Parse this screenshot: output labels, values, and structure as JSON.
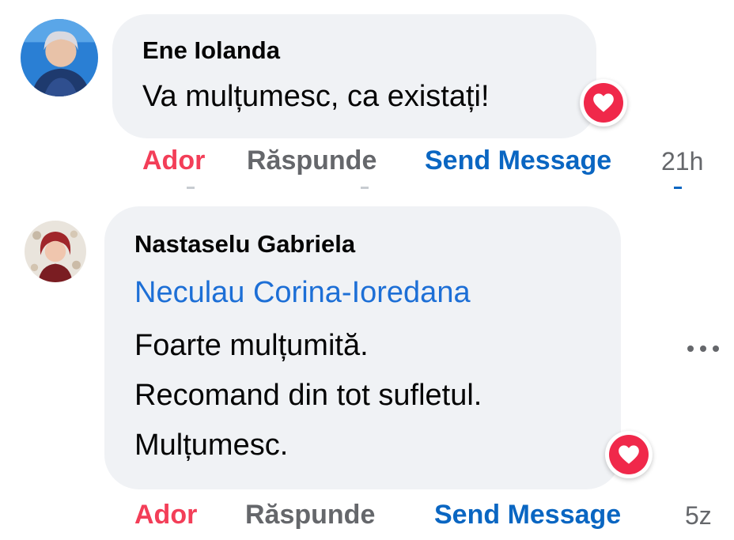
{
  "comments": [
    {
      "author": "Ene Iolanda",
      "lines": [
        "Va mulțumesc, ca existați!"
      ],
      "reaction": "heart-love",
      "actions": {
        "like": "Ador",
        "reply": "Răspunde",
        "send": "Send Message"
      },
      "time": "21h"
    },
    {
      "author": "Nastaselu Gabriela",
      "mention": "Neculau Corina-Ioredana",
      "lines": [
        "Foarte mulțumită.",
        "Recomand din tot sufletul.",
        "Mulțumesc."
      ],
      "reaction": "heart-love",
      "actions": {
        "like": "Ador",
        "reply": "Răspunde",
        "send": "Send Message"
      },
      "time": "5z"
    }
  ],
  "colors": {
    "bubble": "#f0f2f5",
    "like": "#f33e58",
    "send": "#0a66c2",
    "mention": "#1d6fd6",
    "muted": "#65676b"
  },
  "icons": {
    "reaction": "heart-icon",
    "more": "more-options-icon"
  }
}
